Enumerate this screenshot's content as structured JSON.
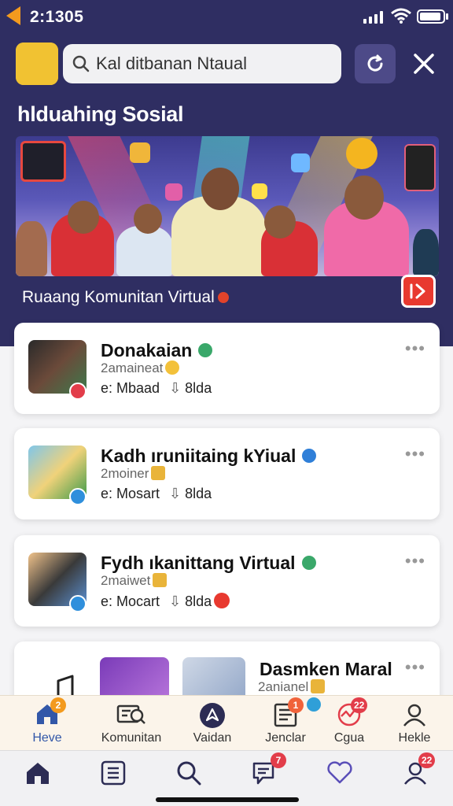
{
  "status": {
    "time": "2:1305"
  },
  "search": {
    "value": "Kal ditbanan Ntaual"
  },
  "section": {
    "title": "hlduahing Sosial"
  },
  "hero": {
    "caption": "Ruaang Komunitan Virtual"
  },
  "cards": [
    {
      "title": "Donakaian",
      "subtitle": "2amaineat",
      "meta_a": "e: Mbaad",
      "meta_b": "8lda",
      "verify_color": "#3aa86a",
      "badge_color": "#e23d4a"
    },
    {
      "title": "Kadh ıruniitaing kYiual",
      "subtitle": "2moiner",
      "meta_a": "e: Mosart",
      "meta_b": "8lda",
      "verify_color": "#2f7fd8",
      "badge_color": "#2f8fdc"
    },
    {
      "title": "Fydh ıkanittang Virtual",
      "subtitle": "2maiwet",
      "meta_a": "e: Mocart",
      "meta_b": "8lda",
      "verify_color": "#3aa86a",
      "badge_color": "#2f8fdc"
    },
    {
      "title": "Dasmken Maral",
      "subtitle": "2anianel"
    }
  ],
  "tabs_top": [
    {
      "label": "Heve",
      "icon": "home-icon",
      "active": true,
      "badge": "2"
    },
    {
      "label": "Komunitan",
      "icon": "community-icon"
    },
    {
      "label": "Vaidan",
      "icon": "compass-icon"
    },
    {
      "label": "Jenclar",
      "icon": "document-icon",
      "badge": "1"
    },
    {
      "label": "Cgua",
      "icon": "activity-icon",
      "badge": "22"
    },
    {
      "label": "Hekle",
      "icon": "profile-icon"
    }
  ],
  "tabs_bottom": [
    {
      "icon": "home-icon"
    },
    {
      "icon": "list-icon"
    },
    {
      "icon": "search-icon"
    },
    {
      "icon": "chat-icon",
      "badge": "7"
    },
    {
      "icon": "heart-icon"
    },
    {
      "icon": "profile-icon",
      "badge": "22"
    }
  ],
  "colors": {
    "header_bg": "#2f2e62",
    "accent_red": "#e8392f",
    "active_tab": "#3257a8"
  }
}
